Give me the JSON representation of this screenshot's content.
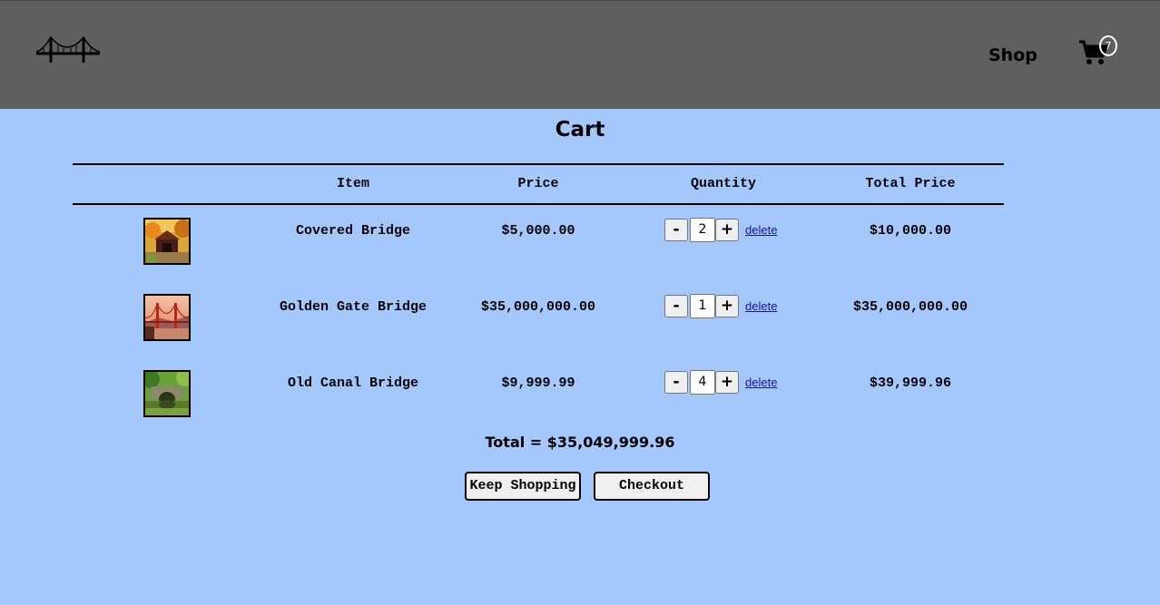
{
  "header": {
    "nav_shop": "Shop",
    "cart_count": "7"
  },
  "page_title": "Cart",
  "table": {
    "columns": [
      "",
      "Item",
      "Price",
      "Quantity",
      "Total Price"
    ],
    "rows": [
      {
        "item": "Covered Bridge",
        "price": "$5,000.00",
        "quantity": "2",
        "minus": "-",
        "plus": "+",
        "delete": "delete",
        "total": "$10,000.00"
      },
      {
        "item": "Golden Gate Bridge",
        "price": "$35,000,000.00",
        "quantity": "1",
        "minus": "-",
        "plus": "+",
        "delete": "delete",
        "total": "$35,000,000.00"
      },
      {
        "item": "Old Canal Bridge",
        "price": "$9,999.99",
        "quantity": "4",
        "minus": "-",
        "plus": "+",
        "delete": "delete",
        "total": "$39,999.96"
      }
    ]
  },
  "grand_total": "Total = $35,049,999.96",
  "actions": {
    "keep_shopping": "Keep Shopping",
    "checkout": "Checkout"
  },
  "colors": {
    "page_bg": "#a5c8fc",
    "header_bg": "#5f5f5f",
    "link": "#1a0dab"
  }
}
